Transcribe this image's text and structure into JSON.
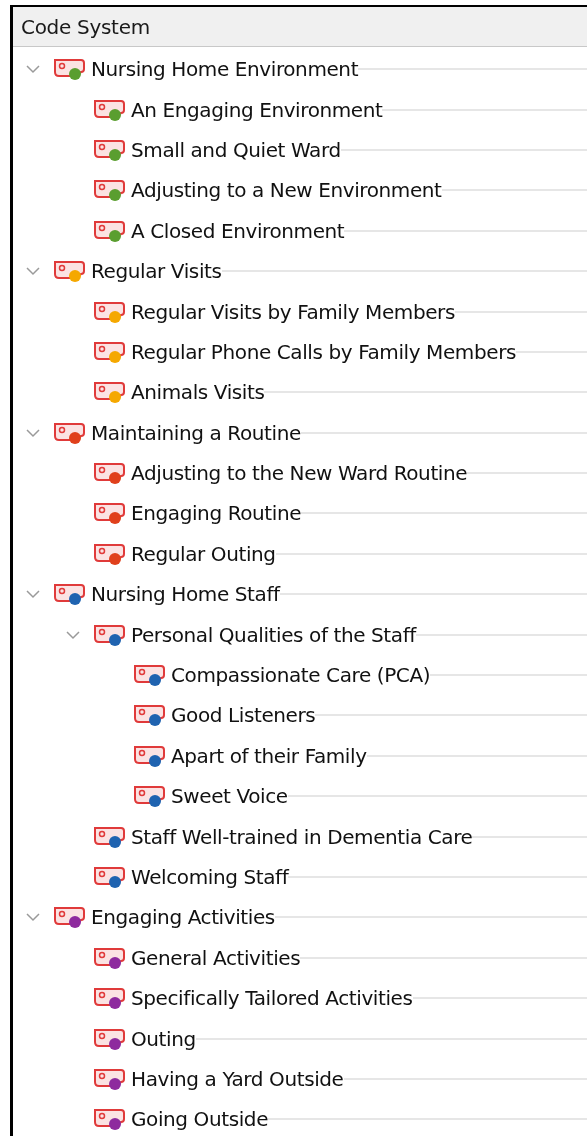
{
  "panel": {
    "title": "Code System"
  },
  "codes": [
    {
      "label": "Nursing Home Environment",
      "color": "#5a9e2f",
      "expanded": true,
      "children": [
        {
          "label": "An Engaging Environment",
          "color": "#5a9e2f"
        },
        {
          "label": "Small and Quiet Ward",
          "color": "#5a9e2f"
        },
        {
          "label": "Adjusting to a New Environment",
          "color": "#5a9e2f"
        },
        {
          "label": "A Closed Environment",
          "color": "#5a9e2f"
        }
      ]
    },
    {
      "label": "Regular Visits",
      "color": "#f5a800",
      "expanded": true,
      "children": [
        {
          "label": "Regular Visits by Family Members",
          "color": "#f5a800"
        },
        {
          "label": "Regular Phone Calls by Family Members",
          "color": "#f5a800"
        },
        {
          "label": "Animals Visits",
          "color": "#f5a800"
        }
      ]
    },
    {
      "label": "Maintaining a Routine",
      "color": "#e0401c",
      "expanded": true,
      "children": [
        {
          "label": "Adjusting to the New Ward Routine",
          "color": "#e0401c"
        },
        {
          "label": "Engaging Routine",
          "color": "#e0401c"
        },
        {
          "label": "Regular Outing",
          "color": "#e0401c"
        }
      ]
    },
    {
      "label": "Nursing Home Staff",
      "color": "#1f63b0",
      "expanded": true,
      "children": [
        {
          "label": "Personal Qualities of the Staff",
          "color": "#1f63b0",
          "expanded": true,
          "children": [
            {
              "label": "Compassionate Care (PCA)",
              "color": "#1f63b0"
            },
            {
              "label": "Good Listeners",
              "color": "#1f63b0"
            },
            {
              "label": "Apart of their Family",
              "color": "#1f63b0"
            },
            {
              "label": "Sweet Voice",
              "color": "#1f63b0"
            }
          ]
        },
        {
          "label": "Staff Well-trained in Dementia Care",
          "color": "#1f63b0"
        },
        {
          "label": "Welcoming Staff",
          "color": "#1f63b0"
        }
      ]
    },
    {
      "label": "Engaging Activities",
      "color": "#8e2a9e",
      "expanded": true,
      "children": [
        {
          "label": "General Activities",
          "color": "#8e2a9e"
        },
        {
          "label": "Specifically Tailored Activities",
          "color": "#8e2a9e"
        },
        {
          "label": "Outing",
          "color": "#8e2a9e"
        },
        {
          "label": "Having a Yard Outside",
          "color": "#8e2a9e"
        },
        {
          "label": "Going Outside",
          "color": "#8e2a9e"
        }
      ]
    }
  ]
}
